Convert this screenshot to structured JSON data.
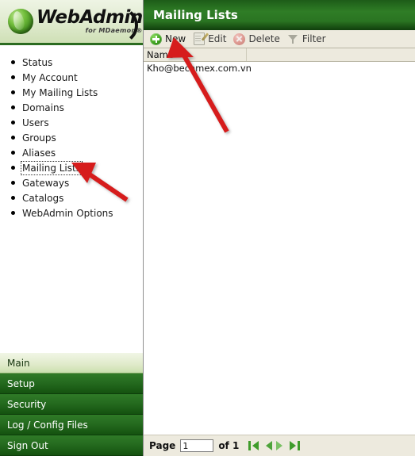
{
  "sidebar": {
    "logo": {
      "name": "WebAdmin",
      "tagline": "for MDaemon®"
    },
    "nav_items": [
      {
        "label": "Status",
        "focused": false
      },
      {
        "label": "My Account",
        "focused": false
      },
      {
        "label": "My Mailing Lists",
        "focused": false
      },
      {
        "label": "Domains",
        "focused": false
      },
      {
        "label": "Users",
        "focused": false
      },
      {
        "label": "Groups",
        "focused": false
      },
      {
        "label": "Aliases",
        "focused": false
      },
      {
        "label": "Mailing Lists",
        "focused": true
      },
      {
        "label": "Gateways",
        "focused": false
      },
      {
        "label": "Catalogs",
        "focused": false
      },
      {
        "label": "WebAdmin Options",
        "focused": false
      }
    ],
    "section_tabs": [
      {
        "label": "Main",
        "active": true
      },
      {
        "label": "Setup",
        "active": false
      },
      {
        "label": "Security",
        "active": false
      },
      {
        "label": "Log / Config Files",
        "active": false
      },
      {
        "label": "Sign Out",
        "active": false
      }
    ]
  },
  "content": {
    "header_title": "Mailing Lists",
    "toolbar": [
      {
        "label": "New",
        "icon": "plus-circle-icon",
        "enabled": true
      },
      {
        "label": "Edit",
        "icon": "pencil-document-icon",
        "enabled": false
      },
      {
        "label": "Delete",
        "icon": "delete-circle-icon",
        "enabled": false
      },
      {
        "label": "Filter",
        "icon": "funnel-icon",
        "enabled": false
      }
    ],
    "grid": {
      "columns": [
        "Name"
      ],
      "rows": [
        {
          "name": "Kho@becamex.com.vn"
        }
      ]
    },
    "pager": {
      "page_label": "Page",
      "page_value": "1",
      "of_label": "of 1",
      "buttons": [
        {
          "name": "first-page-button",
          "glyph": "first"
        },
        {
          "name": "previous-page-button",
          "glyph": "prev"
        },
        {
          "name": "next-page-button",
          "glyph": "next"
        },
        {
          "name": "last-page-button",
          "glyph": "last"
        }
      ]
    }
  },
  "annotations": {
    "arrow_color": "#d61f1f",
    "arrows": [
      {
        "name": "arrow-pointing-to-new-button",
        "target": "New toolbar button"
      },
      {
        "name": "arrow-pointing-to-mailing-lists",
        "target": "Mailing Lists nav item"
      }
    ]
  }
}
